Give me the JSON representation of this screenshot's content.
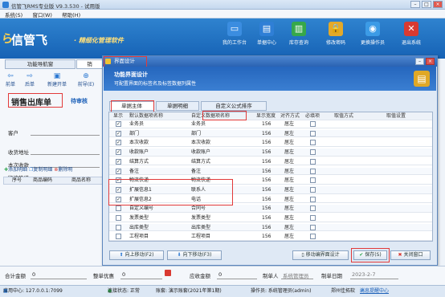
{
  "window": {
    "title": "信管飞RMS专业版 V9.3.530 - 试用版"
  },
  "menu": [
    "系统(S)",
    "窗口(W)",
    "帮助(H)"
  ],
  "banner": {
    "logo": "信管飞",
    "slogan": "· 精细化管理软件",
    "buttons": [
      {
        "label": "我的工作台",
        "icon": "monitor-icon",
        "color": "#3b8de0"
      },
      {
        "label": "单据中心",
        "icon": "document-icon",
        "color": "#2f7fd6"
      },
      {
        "label": "库存查询",
        "icon": "chart-icon",
        "color": "#36a84a"
      },
      {
        "label": "修改密码",
        "icon": "lock-icon",
        "color": "#e3a92a"
      },
      {
        "label": "更换操作员",
        "icon": "users-icon",
        "color": "#3c9be6"
      },
      {
        "label": "退出系统",
        "icon": "close-icon",
        "color": "#d93a32"
      }
    ]
  },
  "left": {
    "tabs": [
      "功能导航窗",
      "销"
    ],
    "toolbar": [
      "前单",
      "后单",
      "新建开单",
      "前导(E)"
    ],
    "doc_title": "销售出库单",
    "pending": "待审核",
    "fields": [
      "客户",
      "收货地址",
      "本次收款",
      "物流快递"
    ],
    "row_actions": [
      "添加明细",
      "复制明细",
      "删除明"
    ],
    "columns": [
      "序号",
      "商品编码",
      "商品名称"
    ]
  },
  "dialog": {
    "title": "界面设计",
    "heading": "功能界面设计",
    "subheading": "可配置界面的标签名及标签数据列属性",
    "tabs": [
      "单据主体",
      "单据明细",
      "自定义公式排序"
    ],
    "columns": [
      "显示",
      "默认数据项名称",
      "自定义数据项名称",
      "显示宽度",
      "对齐方式",
      "必填项",
      "取值方式",
      "取值设置"
    ],
    "rows": [
      {
        "show": true,
        "default": "业务员",
        "custom": "业务员",
        "width": "156",
        "align": "居左",
        "required": false
      },
      {
        "show": true,
        "default": "部门",
        "custom": "部门",
        "width": "156",
        "align": "居左",
        "required": false
      },
      {
        "show": true,
        "default": "本次收款",
        "custom": "本次收款",
        "width": "156",
        "align": "居左",
        "required": false
      },
      {
        "show": true,
        "default": "收款账户",
        "custom": "收款账户",
        "width": "156",
        "align": "居左",
        "required": false
      },
      {
        "show": true,
        "default": "结算方式",
        "custom": "结算方式",
        "width": "156",
        "align": "居左",
        "required": false
      },
      {
        "show": true,
        "default": "备注",
        "custom": "备注",
        "width": "156",
        "align": "居左",
        "required": false
      },
      {
        "show": true,
        "default": "物流快递",
        "custom": "物流快递",
        "width": "156",
        "align": "居左",
        "required": false
      },
      {
        "show": true,
        "default": "扩展信息1",
        "custom": "联系人",
        "width": "156",
        "align": "居左",
        "required": false
      },
      {
        "show": true,
        "default": "扩展信息2",
        "custom": "电话",
        "width": "156",
        "align": "居左",
        "required": false
      },
      {
        "show": false,
        "default": "自定义编号",
        "custom": "合同号",
        "width": "156",
        "align": "居左",
        "required": false
      },
      {
        "show": false,
        "default": "发票类型",
        "custom": "发票类型",
        "width": "156",
        "align": "居左",
        "required": false
      },
      {
        "show": false,
        "default": "出库类型",
        "custom": "出库类型",
        "width": "156",
        "align": "居左",
        "required": false
      },
      {
        "show": false,
        "default": "工程项目",
        "custom": "工程项目",
        "width": "156",
        "align": "居左",
        "required": false
      }
    ],
    "buttons": {
      "up": "向上移动(F2)",
      "down": "向下移动(F3)",
      "layout": "移动编界面设计",
      "save": "保存(S)",
      "close": "关闭窗口"
    }
  },
  "bottom": {
    "total_label": "合计金额",
    "total_value": "0",
    "discount_label": "整单优惠",
    "discount_value": "0",
    "receivable_label": "应收金额",
    "receivable_value": "0",
    "maker_label": "制单人",
    "maker_value": "系统管理员",
    "date_label": "制单日期",
    "date_value": "2023-2-7"
  },
  "status": {
    "server": "应用中心: 127.0.0.1:7099",
    "conn": "连接状态: 正常",
    "account": "账套: 演示账套(2021年第1期)",
    "operator": "操作员: 系统管理员(admin)",
    "company": "郑州佳拓软",
    "msg": "消息提醒中心"
  }
}
